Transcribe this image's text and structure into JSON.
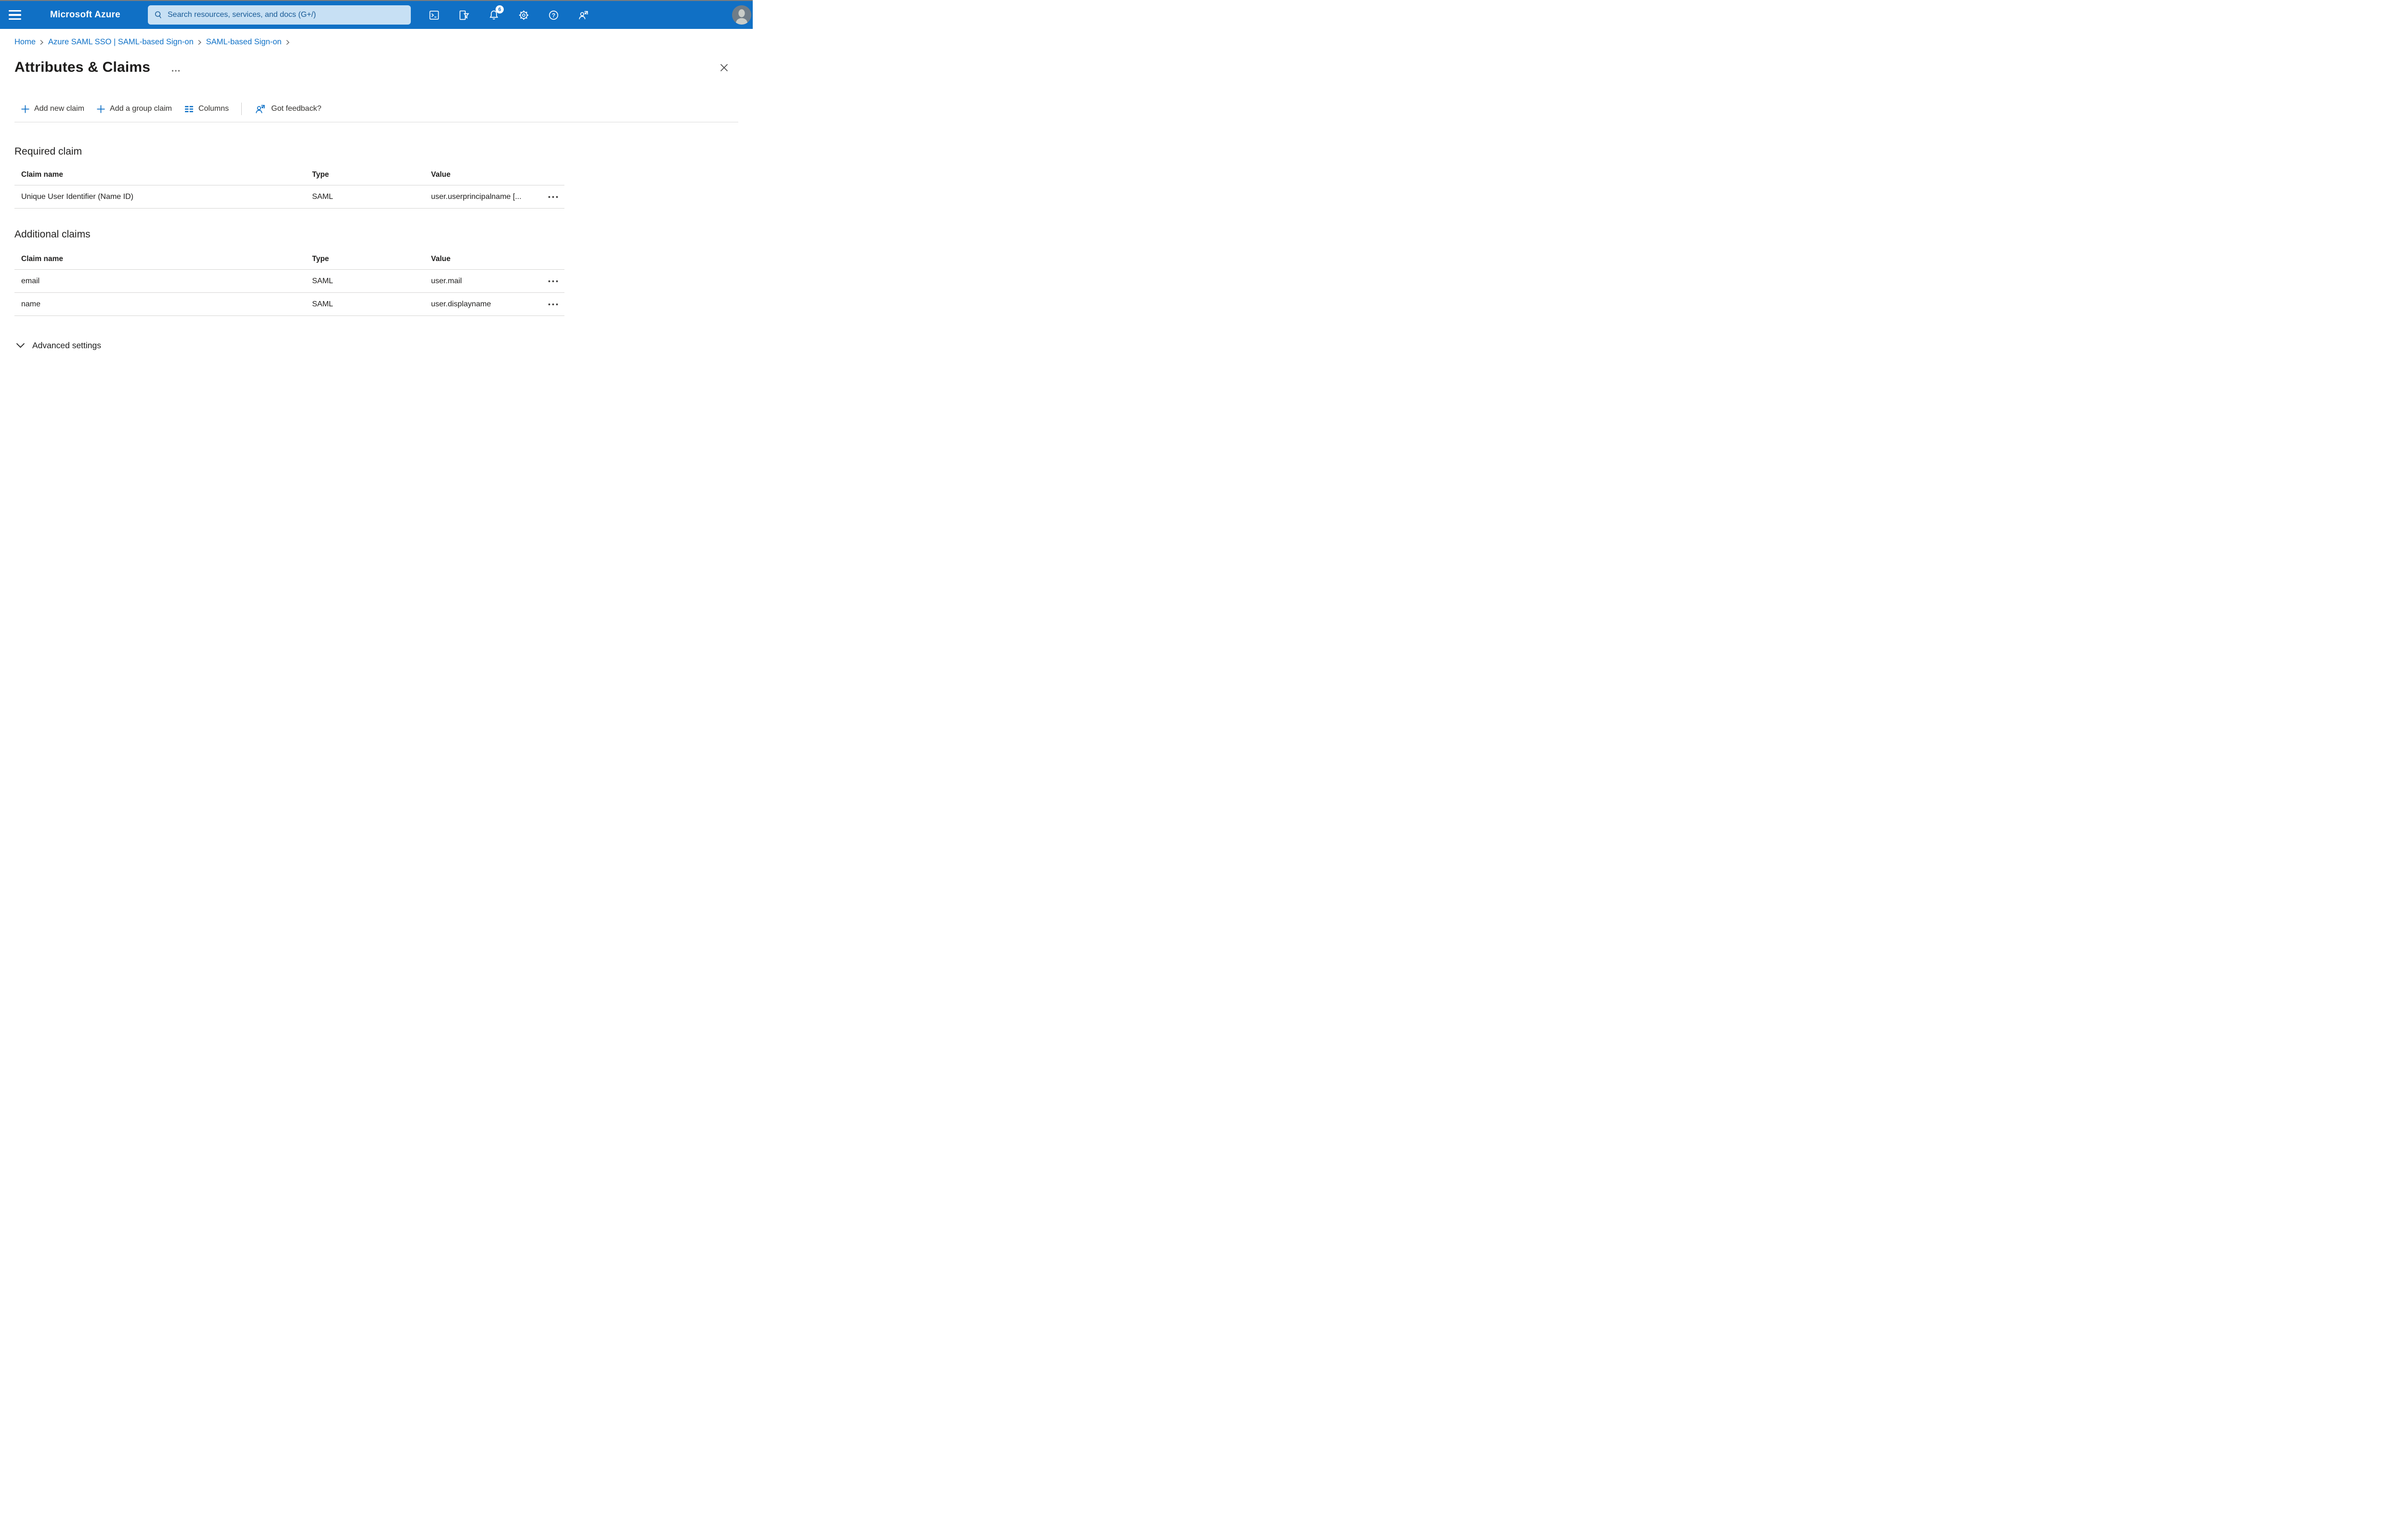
{
  "topbar": {
    "brand": "Microsoft Azure",
    "search_placeholder": "Search resources, services, and docs (G+/)",
    "notification_count": "6"
  },
  "breadcrumb": {
    "items": [
      {
        "label": "Home"
      },
      {
        "label": "Azure SAML SSO | SAML-based Sign-on"
      },
      {
        "label": "SAML-based Sign-on"
      }
    ]
  },
  "page": {
    "title": "Attributes & Claims"
  },
  "toolbar": {
    "add_new_claim": "Add new claim",
    "add_group_claim": "Add a group claim",
    "columns": "Columns",
    "got_feedback": "Got feedback?"
  },
  "required": {
    "heading": "Required claim",
    "columns": [
      "Claim name",
      "Type",
      "Value"
    ],
    "rows": [
      {
        "name": "Unique User Identifier (Name ID)",
        "type": "SAML",
        "value": "user.userprincipalname [..."
      }
    ]
  },
  "additional": {
    "heading": "Additional claims",
    "columns": [
      "Claim name",
      "Type",
      "Value"
    ],
    "rows": [
      {
        "name": "email",
        "type": "SAML",
        "value": "user.mail"
      },
      {
        "name": "name",
        "type": "SAML",
        "value": "user.displayname"
      }
    ]
  },
  "advanced": {
    "label": "Advanced settings"
  },
  "colors": {
    "topbar_bg": "#1070c5",
    "search_bg": "#c7e0f4",
    "search_text": "#175a96",
    "accent_blue": "#1172c7",
    "text_dark": "#201f1e",
    "divider": "#d6d5d4"
  }
}
